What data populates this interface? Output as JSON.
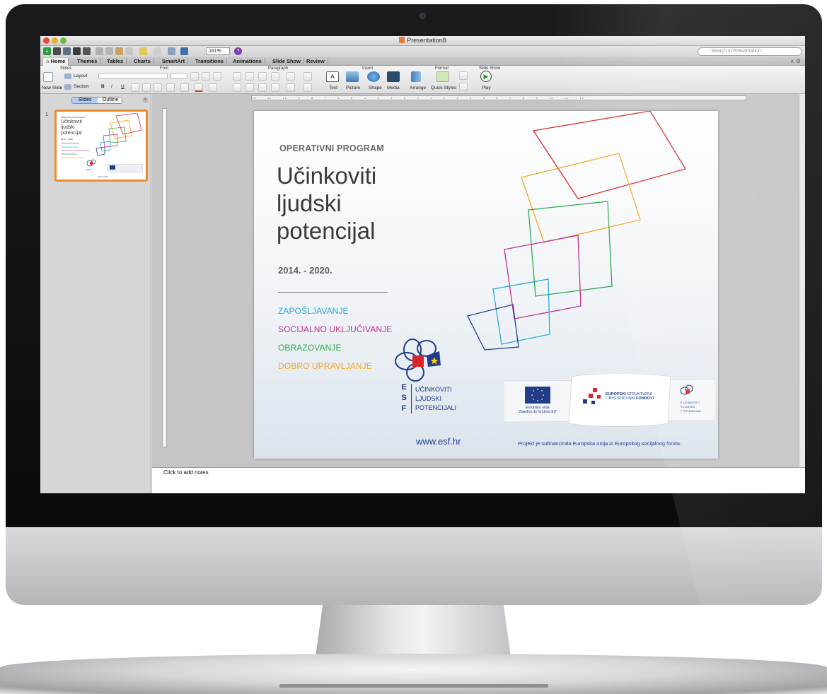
{
  "window": {
    "title": "Presentation8",
    "zoom": "161%",
    "help": "?",
    "search_placeholder": "Search in Presentation"
  },
  "tabs": [
    {
      "label": "Home",
      "active": true
    },
    {
      "label": "Themes"
    },
    {
      "label": "Tables"
    },
    {
      "label": "Charts"
    },
    {
      "label": "SmartArt"
    },
    {
      "label": "Transitions"
    },
    {
      "label": "Animations"
    },
    {
      "label": "Slide Show"
    },
    {
      "label": "Review"
    }
  ],
  "ribbon": {
    "groups": [
      "Slides",
      "Font",
      "Paragraph",
      "Insert",
      "Format",
      "Slide Show"
    ],
    "new_slide": "New Slide",
    "layout": "Layout",
    "section": "Section",
    "bold": "B",
    "italic": "I",
    "underline": "U",
    "text": "Text",
    "picture": "Picture",
    "shape": "Shape",
    "media": "Media",
    "arrange": "Arrange",
    "quick_styles": "Quick Styles",
    "play": "Play"
  },
  "sidebar": {
    "tab_slides": "Slides",
    "tab_outline": "Outline",
    "slide_number": "1"
  },
  "ruler_text": "12 · · · 11 · · · 10 · · · 9 · · · 8 · · · 7 · · · 6 · · · 5 · · · 4 · · · 3 · · · 2 · · · 1 · · · 0 · · · 1 · · · 2 · · · 3 · · · 4 · · · 5 · · · 6 · · · 7 · · · 8 · · · 9 · · · 10 · · · 11 · · · 12",
  "slide": {
    "eyebrow": "OPERATIVNI PROGRAM",
    "title_lines": [
      "Učinkoviti",
      "ljudski",
      "potencijal"
    ],
    "years": "2014. - 2020.",
    "items": [
      {
        "text": "ZAPOŠLJAVANJE",
        "color": "#29a9d6"
      },
      {
        "text": "SOCIJALNO UKLJUČIVANJE",
        "color": "#c2318e"
      },
      {
        "text": "OBRAZOVANJE",
        "color": "#2fa84f"
      },
      {
        "text": "DOBRO UPRAVLJANJE",
        "color": "#f5a623"
      }
    ],
    "esf_letters": [
      "E",
      "S",
      "F"
    ],
    "esf_words": [
      "UČINKOVITI",
      "LJUDSKI",
      "POTENCIJALI"
    ],
    "eu_caption_1": "Europska unija",
    "eu_caption_2": "\"Zajedno do fondova EU\"",
    "funds_line_1_bold": "EUROPSKI",
    "funds_line_1_rest": " STRUKTURNI",
    "funds_line_2_rest": "I INVESTICIJSKI ",
    "funds_line_2_bold": "FONDOVI",
    "url": "www.esf.hr",
    "credit": "Projekt je sufinancirala Europska unija iz Europskog socijalnog fonda.",
    "square_colors": [
      "#e02424",
      "#f5a623",
      "#2fa84f",
      "#c2318e",
      "#29a9d6",
      "#1f3d8a"
    ]
  },
  "notes_placeholder": "Click to add notes"
}
